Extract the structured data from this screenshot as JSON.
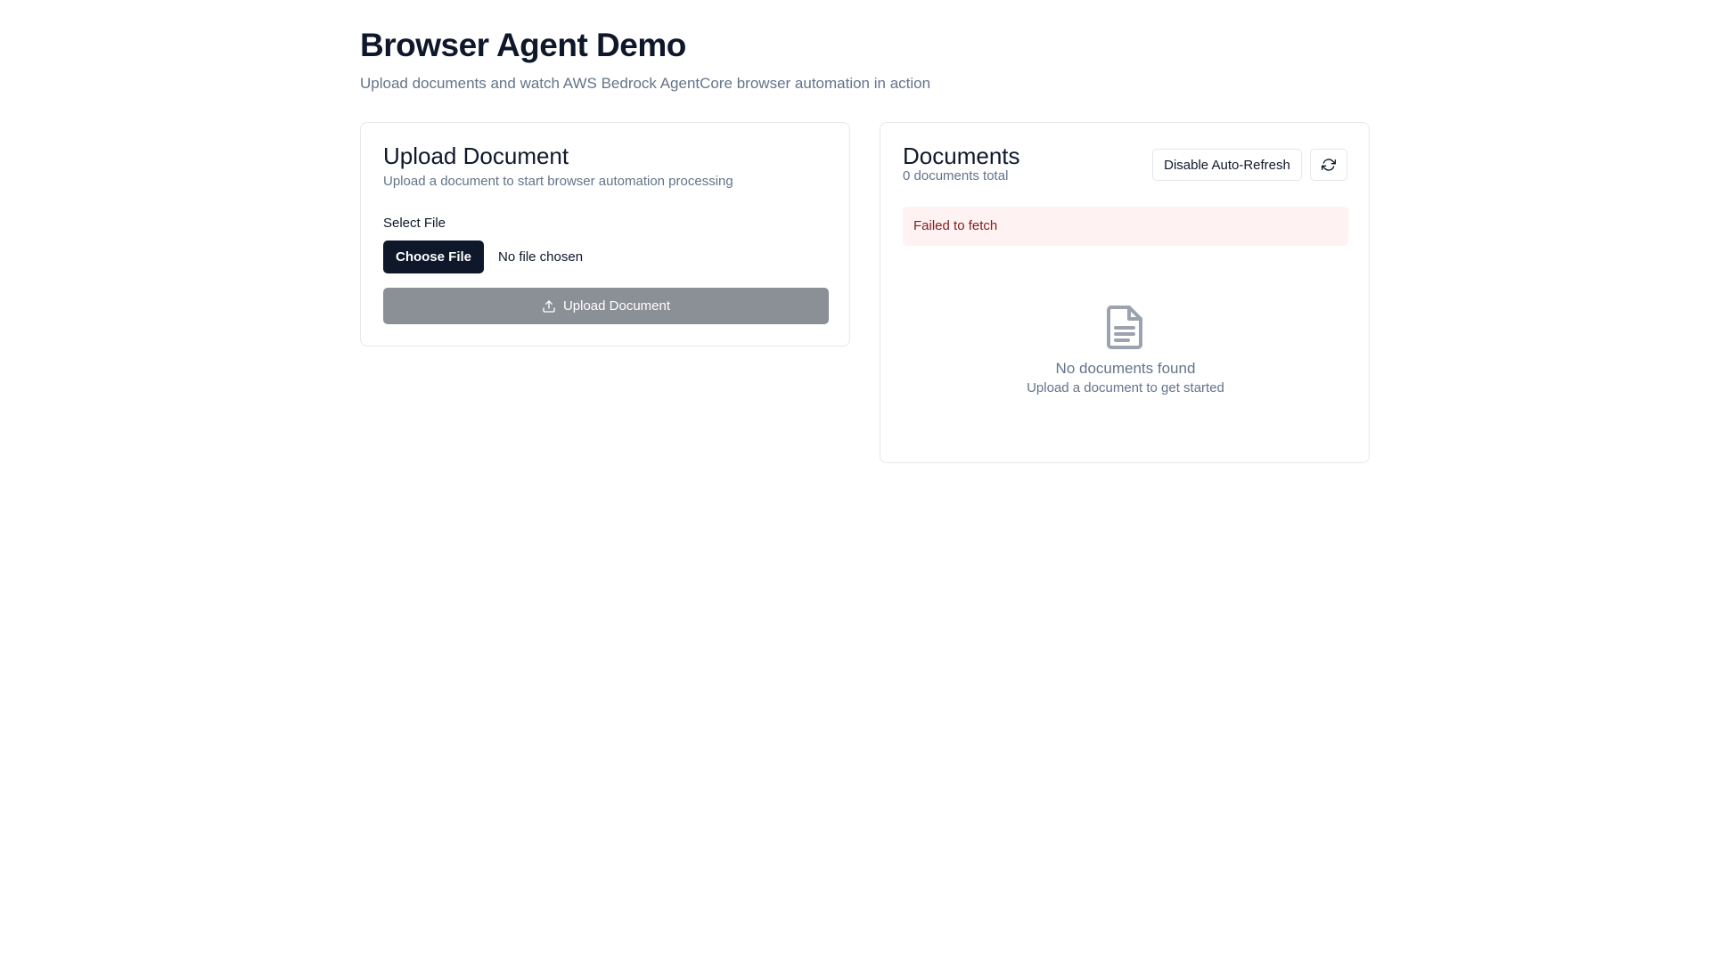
{
  "header": {
    "title": "Browser Agent Demo",
    "subtitle": "Upload documents and watch AWS Bedrock AgentCore browser automation in action"
  },
  "upload_card": {
    "title": "Upload Document",
    "description": "Upload a document to start browser automation processing",
    "file_label": "Select File",
    "choose_file_label": "Choose File",
    "file_status": "No file chosen",
    "upload_button_label": "Upload Document",
    "upload_icon": "upload-icon",
    "upload_button_disabled": true
  },
  "documents_card": {
    "title": "Documents",
    "count_text": "0 documents total",
    "auto_refresh_label": "Disable Auto-Refresh",
    "refresh_icon": "refresh-icon",
    "error_message": "Failed to fetch",
    "empty_icon": "file-text-icon",
    "empty_title": "No documents found",
    "empty_subtitle": "Upload a document to get started"
  },
  "colors": {
    "primary": "#0f172a",
    "muted_text": "#64748b",
    "border": "#e5e7eb",
    "disabled_button": "#8b8f96",
    "error_bg": "#fef2f2",
    "error_text": "#7f1d1d",
    "empty_icon": "#9ca3af"
  }
}
